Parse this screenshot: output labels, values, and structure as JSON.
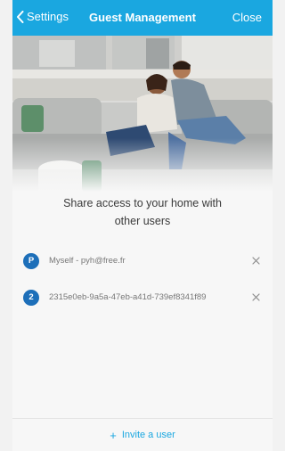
{
  "nav": {
    "back_label": "Settings",
    "title": "Guest Management",
    "close_label": "Close"
  },
  "hero": {
    "image": "couple-on-sofa-photo"
  },
  "share": {
    "line1": "Share access to your home with",
    "line2": "other users"
  },
  "users": [
    {
      "badge": "P",
      "label": "Myself - pyh@free.fr"
    },
    {
      "badge": "2",
      "label": "2315e0eb-9a5a-47eb-a41d-739ef8341f89"
    }
  ],
  "invite": {
    "plus": "+",
    "label": "Invite a user"
  },
  "colors": {
    "nav": "#1aa7e0",
    "avatar": "#1d6fb9",
    "accent": "#1aa7e0"
  }
}
